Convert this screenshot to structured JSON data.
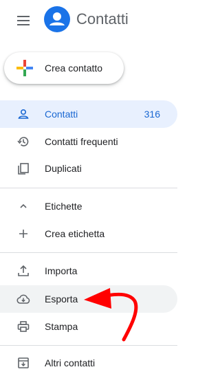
{
  "header": {
    "title": "Contatti"
  },
  "create": {
    "label": "Crea contatto"
  },
  "nav": {
    "contacts": {
      "label": "Contatti",
      "count": "316"
    },
    "frequent": {
      "label": "Contatti frequenti"
    },
    "duplicates": {
      "label": "Duplicati"
    },
    "labels": {
      "label": "Etichette"
    },
    "create_label": {
      "label": "Crea etichetta"
    },
    "import": {
      "label": "Importa"
    },
    "export": {
      "label": "Esporta"
    },
    "print": {
      "label": "Stampa"
    },
    "other": {
      "label": "Altri contatti"
    }
  },
  "icons": {
    "menu": "menu-icon",
    "logo": "person-icon",
    "create": "plus-icon",
    "contacts": "person-outline-icon",
    "frequent": "history-icon",
    "duplicates": "copy-icon",
    "labels": "chevron-up-icon",
    "create_label": "plus-icon",
    "import": "upload-icon",
    "export": "cloud-download-icon",
    "print": "printer-icon",
    "other": "archive-icon"
  },
  "colors": {
    "accent": "#1a73e8",
    "active_bg": "#e8f0fe",
    "active_text": "#1967d2",
    "hover_bg": "#f1f3f4",
    "annotation_arrow": "#ff0000"
  }
}
